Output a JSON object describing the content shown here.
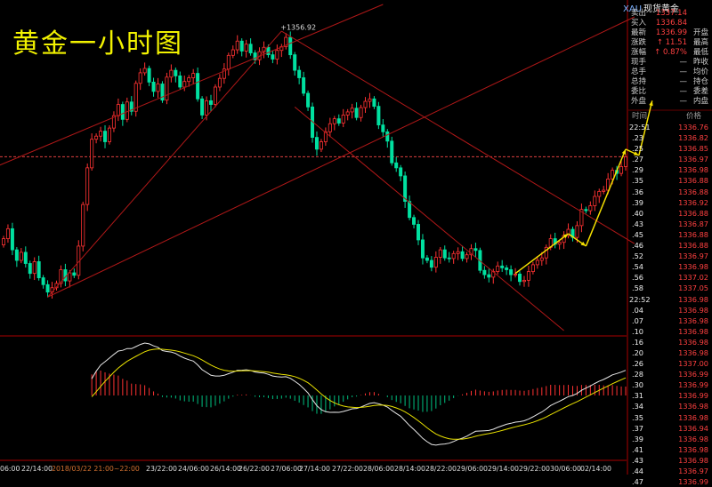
{
  "header": {
    "symbol_code": "XAU",
    "symbol_name": "现货黄金"
  },
  "chart_title": "黄金一小时图",
  "quote_panel": {
    "rows": [
      {
        "label": "卖出",
        "value": "1337.14",
        "right": ""
      },
      {
        "label": "买入",
        "value": "1336.84",
        "right": ""
      },
      {
        "label": "最新",
        "value": "1336.99",
        "right": "开盘"
      },
      {
        "label": "涨跌",
        "value": "↑ 11.51",
        "right": "最高"
      },
      {
        "label": "涨幅",
        "value": "↑ 0.87%",
        "right": "最低"
      },
      {
        "label": "现手",
        "value": "—",
        "right": "昨收"
      },
      {
        "label": "总手",
        "value": "—",
        "right": "均价"
      },
      {
        "label": "总持",
        "value": "—",
        "right": "持仓"
      },
      {
        "label": "委比",
        "value": "—",
        "right": "委差"
      },
      {
        "label": "外盘",
        "value": "—",
        "right": "内盘"
      }
    ]
  },
  "tick_table": {
    "col_time": "时间",
    "col_price": "价格",
    "rows": [
      {
        "time": "22:51",
        "price": "1336.76"
      },
      {
        "time": ".23",
        "price": "1336.82"
      },
      {
        "time": ".25",
        "price": "1336.85"
      },
      {
        "time": ".27",
        "price": "1336.97"
      },
      {
        "time": ".29",
        "price": "1336.98"
      },
      {
        "time": ".35",
        "price": "1336.88"
      },
      {
        "time": ".36",
        "price": "1336.88"
      },
      {
        "time": ".39",
        "price": "1336.92"
      },
      {
        "time": ".40",
        "price": "1336.88"
      },
      {
        "time": ".43",
        "price": "1336.87"
      },
      {
        "time": ".45",
        "price": "1336.88"
      },
      {
        "time": ".46",
        "price": "1336.88"
      },
      {
        "time": ".52",
        "price": "1336.97"
      },
      {
        "time": ".54",
        "price": "1336.98"
      },
      {
        "time": ".56",
        "price": "1337.02"
      },
      {
        "time": ".58",
        "price": "1337.05"
      },
      {
        "time": "22:52",
        "price": "1336.98"
      },
      {
        "time": ".04",
        "price": "1336.98"
      },
      {
        "time": ".07",
        "price": "1336.98"
      },
      {
        "time": ".10",
        "price": "1336.98"
      },
      {
        "time": ".16",
        "price": "1336.98"
      },
      {
        "time": ".20",
        "price": "1336.98"
      },
      {
        "time": ".26",
        "price": "1337.00"
      },
      {
        "time": ".28",
        "price": "1336.99"
      },
      {
        "time": ".30",
        "price": "1336.99"
      },
      {
        "time": ".31",
        "price": "1336.99"
      },
      {
        "time": ".34",
        "price": "1336.98"
      },
      {
        "time": ".35",
        "price": "1336.98"
      },
      {
        "time": ".37",
        "price": "1336.94"
      },
      {
        "time": ".39",
        "price": "1336.98"
      },
      {
        "time": ".41",
        "price": "1336.98"
      },
      {
        "time": ".43",
        "price": "1336.98"
      },
      {
        "time": ".44",
        "price": "1336.97"
      },
      {
        "time": ".47",
        "price": "1336.99"
      }
    ]
  },
  "chart_data": {
    "type": "candlestick",
    "title": "黄金一小时图",
    "x_tick_labels": [
      "06:00",
      "22/14:00",
      "2018/03/22 21:00~22:00",
      "23/22:00",
      "24/06:00",
      "26/14:00",
      "26/22:00",
      "27/06:00",
      "27/14:00",
      "27/22:00",
      "28/06:00",
      "28/14:00",
      "28/22:00",
      "29/06:00",
      "29/14:00",
      "29/22:00",
      "30/06:00",
      "02/14:00"
    ],
    "highlighted_x_label": "2018/03/22 21:00~22:00",
    "annotation_high": "1356.92",
    "reference_price": 1336.99,
    "closes": [
      1323.8,
      1325.4,
      1322.0,
      1320.3,
      1321.6,
      1319.8,
      1318.2,
      1320.1,
      1317.5,
      1316.4,
      1315.2,
      1315.9,
      1316.6,
      1318.8,
      1317.0,
      1318.3,
      1317.9,
      1322.6,
      1329.3,
      1335.2,
      1339.8,
      1340.3,
      1341.1,
      1339.4,
      1341.6,
      1343.6,
      1345.4,
      1343.0,
      1345.8,
      1344.3,
      1348.8,
      1350.5,
      1351.2,
      1349.0,
      1347.5,
      1348.7,
      1346.1,
      1349.8,
      1350.9,
      1350.0,
      1348.2,
      1349.1,
      1349.7,
      1350.4,
      1346.3,
      1343.7,
      1346.0,
      1345.4,
      1348.2,
      1349.6,
      1351.1,
      1353.3,
      1354.2,
      1355.6,
      1354.0,
      1355.1,
      1353.7,
      1352.6,
      1353.9,
      1354.6,
      1353.4,
      1352.7,
      1354.1,
      1354.7,
      1356.2,
      1353.4,
      1350.9,
      1349.7,
      1347.2,
      1345.0,
      1340.1,
      1338.2,
      1339.4,
      1341.0,
      1342.3,
      1343.1,
      1342.4,
      1343.7,
      1344.2,
      1344.8,
      1343.3,
      1344.9,
      1345.9,
      1346.3,
      1345.1,
      1342.1,
      1341.0,
      1339.5,
      1336.0,
      1335.2,
      1333.9,
      1329.8,
      1327.2,
      1326.1,
      1323.6,
      1320.7,
      1320.3,
      1319.2,
      1320.8,
      1322.0,
      1320.7,
      1320.6,
      1321.4,
      1321.7,
      1320.6,
      1321.2,
      1322.2,
      1321.9,
      1318.7,
      1318.0,
      1317.6,
      1318.5,
      1319.4,
      1319.1,
      1318.8,
      1318.0,
      1318.1,
      1316.9,
      1317.1,
      1318.5,
      1319.6,
      1320.3,
      1320.7,
      1322.4,
      1323.8,
      1322.9,
      1323.2,
      1324.3,
      1325.3,
      1324.0,
      1325.9,
      1328.5,
      1328.3,
      1329.1,
      1330.6,
      1331.4,
      1331.6,
      1333.4,
      1334.8,
      1334.3,
      1335.4,
      1336.99
    ],
    "price_range": [
      1309,
      1360.5
    ],
    "indicator": {
      "name": "MACD",
      "lines": [
        "DIF",
        "DEA"
      ],
      "histogram": true
    }
  }
}
